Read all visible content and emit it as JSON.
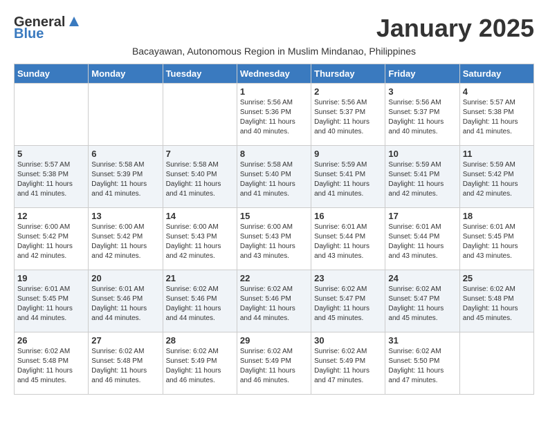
{
  "header": {
    "logo_general": "General",
    "logo_blue": "Blue",
    "month_title": "January 2025",
    "subtitle": "Bacayawan, Autonomous Region in Muslim Mindanao, Philippines"
  },
  "weekdays": [
    "Sunday",
    "Monday",
    "Tuesday",
    "Wednesday",
    "Thursday",
    "Friday",
    "Saturday"
  ],
  "weeks": [
    [
      {
        "day": "",
        "sunrise": "",
        "sunset": "",
        "daylight": ""
      },
      {
        "day": "",
        "sunrise": "",
        "sunset": "",
        "daylight": ""
      },
      {
        "day": "",
        "sunrise": "",
        "sunset": "",
        "daylight": ""
      },
      {
        "day": "1",
        "sunrise": "Sunrise: 5:56 AM",
        "sunset": "Sunset: 5:36 PM",
        "daylight": "Daylight: 11 hours and 40 minutes."
      },
      {
        "day": "2",
        "sunrise": "Sunrise: 5:56 AM",
        "sunset": "Sunset: 5:37 PM",
        "daylight": "Daylight: 11 hours and 40 minutes."
      },
      {
        "day": "3",
        "sunrise": "Sunrise: 5:56 AM",
        "sunset": "Sunset: 5:37 PM",
        "daylight": "Daylight: 11 hours and 40 minutes."
      },
      {
        "day": "4",
        "sunrise": "Sunrise: 5:57 AM",
        "sunset": "Sunset: 5:38 PM",
        "daylight": "Daylight: 11 hours and 41 minutes."
      }
    ],
    [
      {
        "day": "5",
        "sunrise": "Sunrise: 5:57 AM",
        "sunset": "Sunset: 5:38 PM",
        "daylight": "Daylight: 11 hours and 41 minutes."
      },
      {
        "day": "6",
        "sunrise": "Sunrise: 5:58 AM",
        "sunset": "Sunset: 5:39 PM",
        "daylight": "Daylight: 11 hours and 41 minutes."
      },
      {
        "day": "7",
        "sunrise": "Sunrise: 5:58 AM",
        "sunset": "Sunset: 5:40 PM",
        "daylight": "Daylight: 11 hours and 41 minutes."
      },
      {
        "day": "8",
        "sunrise": "Sunrise: 5:58 AM",
        "sunset": "Sunset: 5:40 PM",
        "daylight": "Daylight: 11 hours and 41 minutes."
      },
      {
        "day": "9",
        "sunrise": "Sunrise: 5:59 AM",
        "sunset": "Sunset: 5:41 PM",
        "daylight": "Daylight: 11 hours and 41 minutes."
      },
      {
        "day": "10",
        "sunrise": "Sunrise: 5:59 AM",
        "sunset": "Sunset: 5:41 PM",
        "daylight": "Daylight: 11 hours and 42 minutes."
      },
      {
        "day": "11",
        "sunrise": "Sunrise: 5:59 AM",
        "sunset": "Sunset: 5:42 PM",
        "daylight": "Daylight: 11 hours and 42 minutes."
      }
    ],
    [
      {
        "day": "12",
        "sunrise": "Sunrise: 6:00 AM",
        "sunset": "Sunset: 5:42 PM",
        "daylight": "Daylight: 11 hours and 42 minutes."
      },
      {
        "day": "13",
        "sunrise": "Sunrise: 6:00 AM",
        "sunset": "Sunset: 5:42 PM",
        "daylight": "Daylight: 11 hours and 42 minutes."
      },
      {
        "day": "14",
        "sunrise": "Sunrise: 6:00 AM",
        "sunset": "Sunset: 5:43 PM",
        "daylight": "Daylight: 11 hours and 42 minutes."
      },
      {
        "day": "15",
        "sunrise": "Sunrise: 6:00 AM",
        "sunset": "Sunset: 5:43 PM",
        "daylight": "Daylight: 11 hours and 43 minutes."
      },
      {
        "day": "16",
        "sunrise": "Sunrise: 6:01 AM",
        "sunset": "Sunset: 5:44 PM",
        "daylight": "Daylight: 11 hours and 43 minutes."
      },
      {
        "day": "17",
        "sunrise": "Sunrise: 6:01 AM",
        "sunset": "Sunset: 5:44 PM",
        "daylight": "Daylight: 11 hours and 43 minutes."
      },
      {
        "day": "18",
        "sunrise": "Sunrise: 6:01 AM",
        "sunset": "Sunset: 5:45 PM",
        "daylight": "Daylight: 11 hours and 43 minutes."
      }
    ],
    [
      {
        "day": "19",
        "sunrise": "Sunrise: 6:01 AM",
        "sunset": "Sunset: 5:45 PM",
        "daylight": "Daylight: 11 hours and 44 minutes."
      },
      {
        "day": "20",
        "sunrise": "Sunrise: 6:01 AM",
        "sunset": "Sunset: 5:46 PM",
        "daylight": "Daylight: 11 hours and 44 minutes."
      },
      {
        "day": "21",
        "sunrise": "Sunrise: 6:02 AM",
        "sunset": "Sunset: 5:46 PM",
        "daylight": "Daylight: 11 hours and 44 minutes."
      },
      {
        "day": "22",
        "sunrise": "Sunrise: 6:02 AM",
        "sunset": "Sunset: 5:46 PM",
        "daylight": "Daylight: 11 hours and 44 minutes."
      },
      {
        "day": "23",
        "sunrise": "Sunrise: 6:02 AM",
        "sunset": "Sunset: 5:47 PM",
        "daylight": "Daylight: 11 hours and 45 minutes."
      },
      {
        "day": "24",
        "sunrise": "Sunrise: 6:02 AM",
        "sunset": "Sunset: 5:47 PM",
        "daylight": "Daylight: 11 hours and 45 minutes."
      },
      {
        "day": "25",
        "sunrise": "Sunrise: 6:02 AM",
        "sunset": "Sunset: 5:48 PM",
        "daylight": "Daylight: 11 hours and 45 minutes."
      }
    ],
    [
      {
        "day": "26",
        "sunrise": "Sunrise: 6:02 AM",
        "sunset": "Sunset: 5:48 PM",
        "daylight": "Daylight: 11 hours and 45 minutes."
      },
      {
        "day": "27",
        "sunrise": "Sunrise: 6:02 AM",
        "sunset": "Sunset: 5:48 PM",
        "daylight": "Daylight: 11 hours and 46 minutes."
      },
      {
        "day": "28",
        "sunrise": "Sunrise: 6:02 AM",
        "sunset": "Sunset: 5:49 PM",
        "daylight": "Daylight: 11 hours and 46 minutes."
      },
      {
        "day": "29",
        "sunrise": "Sunrise: 6:02 AM",
        "sunset": "Sunset: 5:49 PM",
        "daylight": "Daylight: 11 hours and 46 minutes."
      },
      {
        "day": "30",
        "sunrise": "Sunrise: 6:02 AM",
        "sunset": "Sunset: 5:49 PM",
        "daylight": "Daylight: 11 hours and 47 minutes."
      },
      {
        "day": "31",
        "sunrise": "Sunrise: 6:02 AM",
        "sunset": "Sunset: 5:50 PM",
        "daylight": "Daylight: 11 hours and 47 minutes."
      },
      {
        "day": "",
        "sunrise": "",
        "sunset": "",
        "daylight": ""
      }
    ]
  ]
}
